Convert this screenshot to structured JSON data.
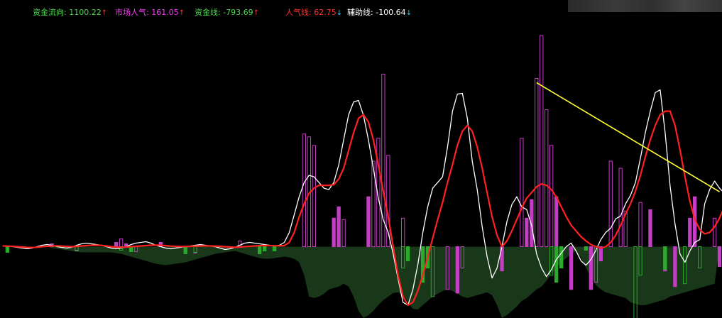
{
  "legend": [
    {
      "name": "资金流向",
      "value": "1100.22",
      "arrow": "↑",
      "color": "#4fd64f",
      "arrow_color": "#ff3a3a"
    },
    {
      "name": "市场人气",
      "value": "161.05",
      "arrow": "↑",
      "color": "#ff3aff",
      "arrow_color": "#ff3a3a"
    },
    {
      "name": "资金线",
      "value": "-793.69",
      "arrow": "↑",
      "color": "#4fd64f",
      "arrow_color": "#ff3a3a"
    },
    {
      "name": "人气线",
      "value": "62.75",
      "arrow": "↓",
      "color": "#ff3030",
      "arrow_color": "#37d4ff"
    },
    {
      "name": "辅助线",
      "value": "-100.64",
      "arrow": "↓",
      "color": "#ffffff",
      "arrow_color": "#37d4ff"
    }
  ],
  "chart_data": {
    "type": "bar",
    "title": "",
    "xlabel": "",
    "ylabel": "",
    "ylim": [
      -1000,
      3200
    ],
    "grid": false,
    "legend_position": "top-left",
    "x": [
      0,
      1,
      2,
      3,
      4,
      5,
      6,
      7,
      8,
      9,
      10,
      11,
      12,
      13,
      14,
      15,
      16,
      17,
      18,
      19,
      20,
      21,
      22,
      23,
      24,
      25,
      26,
      27,
      28,
      29,
      30,
      31,
      32,
      33,
      34,
      35,
      36,
      37,
      38,
      39,
      40,
      41,
      42,
      43,
      44,
      45,
      46,
      47,
      48,
      49,
      50,
      51,
      52,
      53,
      54,
      55,
      56,
      57,
      58,
      59,
      60,
      61,
      62,
      63,
      64,
      65,
      66,
      67,
      68,
      69,
      70,
      71,
      72,
      73,
      74,
      75,
      76,
      77,
      78,
      79,
      80,
      81,
      82,
      83,
      84,
      85,
      86,
      87,
      88,
      89,
      90,
      91,
      92,
      93,
      94,
      95,
      96,
      97,
      98,
      99,
      100,
      101,
      102,
      103,
      104,
      105,
      106,
      107,
      108,
      109,
      110,
      111,
      112,
      113,
      114,
      115,
      116,
      117,
      118,
      119,
      120,
      121,
      122,
      123,
      124,
      125,
      126,
      127,
      128,
      129,
      130,
      131,
      132,
      133,
      134,
      135,
      136,
      137,
      138,
      139,
      140,
      141,
      142,
      143,
      144,
      145
    ],
    "series": [
      {
        "name": "市场人气",
        "kind": "bar",
        "color": "#c23ec2",
        "values": [
          0,
          -60,
          0,
          0,
          0,
          0,
          0,
          0,
          0,
          0,
          40,
          0,
          0,
          0,
          0,
          -50,
          0,
          0,
          0,
          0,
          0,
          0,
          0,
          60,
          110,
          40,
          0,
          -70,
          0,
          0,
          0,
          0,
          60,
          0,
          0,
          0,
          0,
          -60,
          0,
          -90,
          0,
          0,
          0,
          0,
          0,
          0,
          0,
          0,
          80,
          0,
          0,
          0,
          0,
          -60,
          0,
          -60,
          0,
          0,
          0,
          0,
          0,
          1580,
          1540,
          1420,
          0,
          0,
          0,
          400,
          560,
          380,
          0,
          0,
          0,
          0,
          700,
          1200,
          1520,
          2420,
          1280,
          0,
          0,
          400,
          0,
          0,
          0,
          -180,
          0,
          0,
          0,
          0,
          -600,
          0,
          -650,
          -300,
          0,
          0,
          0,
          0,
          0,
          0,
          0,
          -340,
          0,
          0,
          0,
          1520,
          400,
          660,
          2360,
          2960,
          1920,
          1420,
          700,
          0,
          0,
          -600,
          0,
          0,
          0,
          -600,
          -500,
          -200,
          0,
          1200,
          0,
          1100,
          500,
          0,
          0,
          620,
          0,
          520,
          0,
          0,
          -340,
          0,
          -560,
          0,
          0,
          400,
          700,
          0,
          0,
          0,
          400,
          -280,
          0,
          -180,
          0,
          0
        ]
      },
      {
        "name": "资金流向",
        "kind": "bar",
        "color": "#2aaa2a",
        "values": [
          0,
          -80,
          0,
          0,
          0,
          0,
          0,
          0,
          0,
          0,
          0,
          0,
          0,
          0,
          0,
          -60,
          0,
          0,
          0,
          0,
          0,
          0,
          0,
          0,
          -50,
          0,
          -70,
          0,
          0,
          0,
          0,
          0,
          0,
          0,
          0,
          0,
          0,
          -100,
          0,
          -80,
          0,
          0,
          0,
          0,
          0,
          0,
          0,
          0,
          0,
          0,
          0,
          0,
          -100,
          -60,
          0,
          -60,
          0,
          0,
          0,
          0,
          0,
          0,
          0,
          0,
          0,
          0,
          0,
          0,
          0,
          0,
          0,
          0,
          0,
          0,
          0,
          0,
          0,
          0,
          0,
          0,
          0,
          -300,
          -200,
          0,
          0,
          -500,
          -300,
          -700,
          0,
          0,
          0,
          0,
          0,
          0,
          0,
          0,
          0,
          0,
          0,
          0,
          0,
          0,
          0,
          0,
          0,
          0,
          0,
          0,
          0,
          0,
          0,
          -400,
          -500,
          -300,
          0,
          0,
          0,
          0,
          -50,
          0,
          0,
          0,
          0,
          0,
          0,
          0,
          0,
          0,
          -1200,
          -400,
          0,
          0,
          0,
          0,
          -320,
          0,
          0,
          0,
          -520,
          0,
          0,
          -300,
          0,
          0,
          0,
          0,
          0,
          -400,
          0,
          0,
          0,
          0,
          0
        ]
      },
      {
        "name": "辅助线",
        "kind": "line",
        "color": "#ffffff",
        "values": [
          10,
          5,
          0,
          -10,
          -20,
          -30,
          -20,
          0,
          20,
          30,
          20,
          0,
          -10,
          -20,
          -10,
          20,
          40,
          50,
          40,
          30,
          20,
          0,
          -20,
          -30,
          -20,
          0,
          30,
          50,
          60,
          70,
          50,
          20,
          0,
          -20,
          -30,
          -20,
          -10,
          0,
          10,
          20,
          30,
          20,
          10,
          0,
          -20,
          -40,
          -30,
          -10,
          20,
          50,
          60,
          50,
          40,
          30,
          20,
          10,
          20,
          60,
          200,
          450,
          700,
          900,
          1000,
          980,
          900,
          820,
          800,
          900,
          1150,
          1500,
          1850,
          2030,
          2050,
          1840,
          1500,
          1100,
          680,
          380,
          200,
          -100,
          -450,
          -780,
          -820,
          -600,
          -250,
          200,
          560,
          820,
          900,
          980,
          1400,
          1900,
          2140,
          2150,
          1800,
          1200,
          800,
          280,
          -140,
          -440,
          -300,
          0,
          350,
          590,
          700,
          560,
          520,
          300,
          -100,
          -300,
          -420,
          -320,
          -180,
          -90,
          0,
          50,
          -60,
          -200,
          -260,
          -180,
          -50,
          100,
          200,
          260,
          390,
          430,
          600,
          720,
          900,
          1240,
          1600,
          1900,
          2160,
          2200,
          1600,
          850,
          320,
          -100,
          -220,
          -60,
          60,
          100,
          600,
          800,
          920,
          820,
          750,
          600,
          400,
          300
        ]
      },
      {
        "name": "人气线",
        "kind": "line",
        "color": "#ff2020",
        "values": [
          10,
          8,
          5,
          0,
          -5,
          -10,
          -12,
          -8,
          0,
          5,
          10,
          12,
          8,
          4,
          0,
          5,
          10,
          15,
          20,
          20,
          18,
          10,
          0,
          -5,
          -8,
          -5,
          0,
          5,
          10,
          15,
          20,
          22,
          20,
          14,
          8,
          4,
          2,
          2,
          5,
          8,
          10,
          12,
          10,
          8,
          5,
          0,
          -5,
          -8,
          -5,
          0,
          5,
          10,
          14,
          15,
          15,
          13,
          12,
          15,
          60,
          200,
          420,
          600,
          750,
          820,
          860,
          860,
          860,
          870,
          950,
          1100,
          1350,
          1600,
          1800,
          1850,
          1750,
          1500,
          1150,
          780,
          420,
          0,
          -400,
          -700,
          -820,
          -780,
          -620,
          -400,
          -150,
          120,
          380,
          620,
          900,
          1150,
          1420,
          1620,
          1700,
          1620,
          1400,
          1100,
          760,
          420,
          160,
          0,
          80,
          220,
          380,
          540,
          680,
          760,
          840,
          880,
          860,
          800,
          700,
          560,
          420,
          300,
          220,
          140,
          80,
          30,
          0,
          -20,
          0,
          60,
          160,
          300,
          460,
          600,
          780,
          1000,
          1260,
          1500,
          1700,
          1850,
          1900,
          1900,
          1700,
          1360,
          980,
          640,
          380,
          240,
          180,
          200,
          280,
          400,
          560,
          680,
          760,
          800
        ]
      },
      {
        "name": "资金线",
        "kind": "area",
        "color": "#1a3a1a",
        "values": [
          0,
          0,
          0,
          0,
          0,
          0,
          0,
          0,
          0,
          0,
          -20,
          -30,
          -40,
          -50,
          -60,
          -70,
          -80,
          -80,
          -80,
          -80,
          -80,
          -80,
          -80,
          -90,
          -100,
          -120,
          -140,
          -160,
          -180,
          -200,
          -220,
          -240,
          -250,
          -260,
          -250,
          -240,
          -230,
          -220,
          -200,
          -180,
          -160,
          -140,
          -120,
          -100,
          -90,
          -80,
          -70,
          -60,
          -80,
          -100,
          -120,
          -140,
          -160,
          -170,
          -170,
          -160,
          -150,
          -140,
          -150,
          -170,
          -220,
          -400,
          -700,
          -720,
          -700,
          -660,
          -600,
          -580,
          -560,
          -520,
          -560,
          -700,
          -900,
          -1000,
          -960,
          -900,
          -820,
          -750,
          -700,
          -650,
          -640,
          -680,
          -780,
          -870,
          -880,
          -820,
          -760,
          -700,
          -660,
          -620,
          -600,
          -620,
          -660,
          -700,
          -720,
          -700,
          -680,
          -660,
          -640,
          -680,
          -820,
          -1000,
          -960,
          -900,
          -840,
          -760,
          -720,
          -660,
          -600,
          -560,
          -480,
          -380,
          -300,
          -220,
          -160,
          -100,
          -60,
          -160,
          -300,
          -420,
          -540,
          -600,
          -640,
          -660,
          -680,
          -700,
          -720,
          -780,
          -800,
          -820,
          -820,
          -800,
          -780,
          -760,
          -740,
          -700,
          -680,
          -660,
          -640,
          -620,
          -600,
          -580,
          -560,
          -540,
          -520
        ]
      }
    ],
    "trendline": {
      "color": "#ffff33",
      "from": [
        108,
        2300
      ],
      "to": [
        145,
        770
      ]
    }
  }
}
